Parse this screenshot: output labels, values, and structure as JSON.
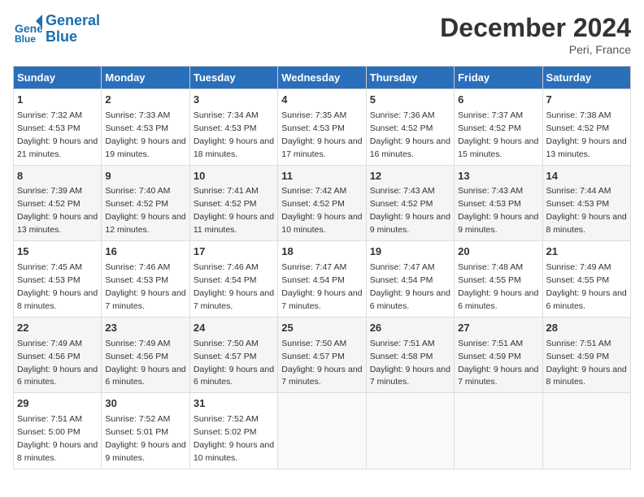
{
  "logo": {
    "line1": "General",
    "line2": "Blue"
  },
  "title": "December 2024",
  "location": "Peri, France",
  "weekdays": [
    "Sunday",
    "Monday",
    "Tuesday",
    "Wednesday",
    "Thursday",
    "Friday",
    "Saturday"
  ],
  "weeks": [
    [
      {
        "day": "1",
        "sunrise": "7:32 AM",
        "sunset": "4:53 PM",
        "daylight": "9 hours and 21 minutes."
      },
      {
        "day": "2",
        "sunrise": "7:33 AM",
        "sunset": "4:53 PM",
        "daylight": "9 hours and 19 minutes."
      },
      {
        "day": "3",
        "sunrise": "7:34 AM",
        "sunset": "4:53 PM",
        "daylight": "9 hours and 18 minutes."
      },
      {
        "day": "4",
        "sunrise": "7:35 AM",
        "sunset": "4:53 PM",
        "daylight": "9 hours and 17 minutes."
      },
      {
        "day": "5",
        "sunrise": "7:36 AM",
        "sunset": "4:52 PM",
        "daylight": "9 hours and 16 minutes."
      },
      {
        "day": "6",
        "sunrise": "7:37 AM",
        "sunset": "4:52 PM",
        "daylight": "9 hours and 15 minutes."
      },
      {
        "day": "7",
        "sunrise": "7:38 AM",
        "sunset": "4:52 PM",
        "daylight": "9 hours and 13 minutes."
      }
    ],
    [
      {
        "day": "8",
        "sunrise": "7:39 AM",
        "sunset": "4:52 PM",
        "daylight": "9 hours and 13 minutes."
      },
      {
        "day": "9",
        "sunrise": "7:40 AM",
        "sunset": "4:52 PM",
        "daylight": "9 hours and 12 minutes."
      },
      {
        "day": "10",
        "sunrise": "7:41 AM",
        "sunset": "4:52 PM",
        "daylight": "9 hours and 11 minutes."
      },
      {
        "day": "11",
        "sunrise": "7:42 AM",
        "sunset": "4:52 PM",
        "daylight": "9 hours and 10 minutes."
      },
      {
        "day": "12",
        "sunrise": "7:43 AM",
        "sunset": "4:52 PM",
        "daylight": "9 hours and 9 minutes."
      },
      {
        "day": "13",
        "sunrise": "7:43 AM",
        "sunset": "4:53 PM",
        "daylight": "9 hours and 9 minutes."
      },
      {
        "day": "14",
        "sunrise": "7:44 AM",
        "sunset": "4:53 PM",
        "daylight": "9 hours and 8 minutes."
      }
    ],
    [
      {
        "day": "15",
        "sunrise": "7:45 AM",
        "sunset": "4:53 PM",
        "daylight": "9 hours and 8 minutes."
      },
      {
        "day": "16",
        "sunrise": "7:46 AM",
        "sunset": "4:53 PM",
        "daylight": "9 hours and 7 minutes."
      },
      {
        "day": "17",
        "sunrise": "7:46 AM",
        "sunset": "4:54 PM",
        "daylight": "9 hours and 7 minutes."
      },
      {
        "day": "18",
        "sunrise": "7:47 AM",
        "sunset": "4:54 PM",
        "daylight": "9 hours and 7 minutes."
      },
      {
        "day": "19",
        "sunrise": "7:47 AM",
        "sunset": "4:54 PM",
        "daylight": "9 hours and 6 minutes."
      },
      {
        "day": "20",
        "sunrise": "7:48 AM",
        "sunset": "4:55 PM",
        "daylight": "9 hours and 6 minutes."
      },
      {
        "day": "21",
        "sunrise": "7:49 AM",
        "sunset": "4:55 PM",
        "daylight": "9 hours and 6 minutes."
      }
    ],
    [
      {
        "day": "22",
        "sunrise": "7:49 AM",
        "sunset": "4:56 PM",
        "daylight": "9 hours and 6 minutes."
      },
      {
        "day": "23",
        "sunrise": "7:49 AM",
        "sunset": "4:56 PM",
        "daylight": "9 hours and 6 minutes."
      },
      {
        "day": "24",
        "sunrise": "7:50 AM",
        "sunset": "4:57 PM",
        "daylight": "9 hours and 6 minutes."
      },
      {
        "day": "25",
        "sunrise": "7:50 AM",
        "sunset": "4:57 PM",
        "daylight": "9 hours and 7 minutes."
      },
      {
        "day": "26",
        "sunrise": "7:51 AM",
        "sunset": "4:58 PM",
        "daylight": "9 hours and 7 minutes."
      },
      {
        "day": "27",
        "sunrise": "7:51 AM",
        "sunset": "4:59 PM",
        "daylight": "9 hours and 7 minutes."
      },
      {
        "day": "28",
        "sunrise": "7:51 AM",
        "sunset": "4:59 PM",
        "daylight": "9 hours and 8 minutes."
      }
    ],
    [
      {
        "day": "29",
        "sunrise": "7:51 AM",
        "sunset": "5:00 PM",
        "daylight": "9 hours and 8 minutes."
      },
      {
        "day": "30",
        "sunrise": "7:52 AM",
        "sunset": "5:01 PM",
        "daylight": "9 hours and 9 minutes."
      },
      {
        "day": "31",
        "sunrise": "7:52 AM",
        "sunset": "5:02 PM",
        "daylight": "9 hours and 10 minutes."
      },
      null,
      null,
      null,
      null
    ]
  ]
}
